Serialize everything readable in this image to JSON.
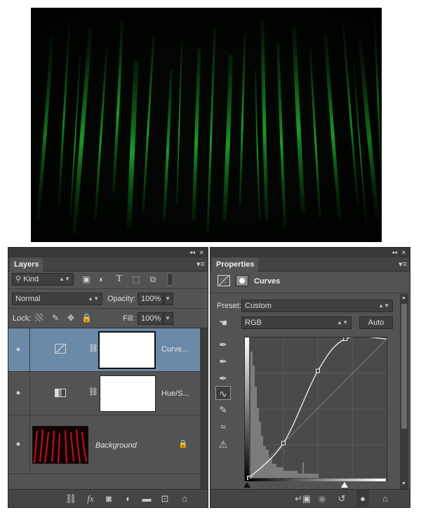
{
  "layers_panel": {
    "tab_label": "Layers",
    "filter_kind": "Kind",
    "blend_mode": "Normal",
    "opacity_label": "Opacity:",
    "opacity_value": "100%",
    "lock_label": "Lock:",
    "fill_label": "Fill:",
    "fill_value": "100%",
    "layers": [
      {
        "name": "Curve...",
        "kind": "curves-adjustment",
        "selected": true
      },
      {
        "name": "Hue/S...",
        "kind": "hue-saturation-adjustment",
        "selected": false
      },
      {
        "name": "Background",
        "kind": "image",
        "selected": false
      }
    ],
    "collapse_glyph": "◂◂",
    "close_glyph": "✕",
    "menu_glyph": "≡"
  },
  "properties_panel": {
    "tab_label": "Properties",
    "title": "Curves",
    "preset_label": "Preset:",
    "preset_value": "Custom",
    "channel_value": "RGB",
    "auto_label": "Auto",
    "curve_points": [
      [
        0,
        0
      ],
      [
        0.25,
        0.25
      ],
      [
        0.5,
        0.77
      ],
      [
        0.7,
        1.0
      ]
    ]
  },
  "icons": {
    "eye": "👁",
    "lock": "🔒",
    "link": "⛓",
    "fx": "fx",
    "trash": "🗑"
  },
  "colors": {
    "panel_bg": "#535353",
    "selected_row": "#6a8aa8",
    "accent_green": "#1faa2c",
    "background_thumb_red": "#b5121b"
  }
}
